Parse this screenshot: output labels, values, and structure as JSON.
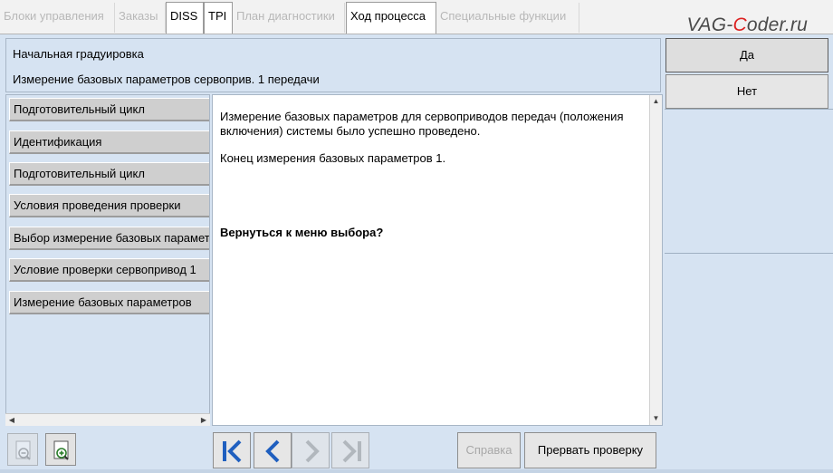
{
  "tabs": [
    {
      "label": "Блоки управления",
      "active": false
    },
    {
      "label": "Заказы",
      "active": false
    },
    {
      "label": "DISS",
      "active": true
    },
    {
      "label": "TPI",
      "active": true
    },
    {
      "label": "План диагностики",
      "active": false
    },
    {
      "label": "Ход процесса",
      "active": true
    },
    {
      "label": "Специальные функции",
      "active": false
    }
  ],
  "watermark": {
    "pre": "VAG-",
    "accent": "C",
    "post": "oder.ru"
  },
  "header": {
    "line1": "Начальная градуировка",
    "line2": "Измерение базовых параметров сервоприв. 1 передачи"
  },
  "steps": [
    "Подготовительный цикл",
    "Идентификация",
    "Подготовительный цикл",
    "Условия проведения проверки",
    "Выбор измерение базовых параметров",
    "Условие проверки сервопривод 1",
    "Измерение базовых параметров"
  ],
  "content": {
    "para1": "Измерение базовых параметров для сервоприводов передач (положения включения)  системы было успешно проведено.",
    "para2": "Конец измерения базовых параметров 1.",
    "question": "Вернуться к меню выбора?"
  },
  "answers": {
    "yes": "Да",
    "no": "Нет"
  },
  "toolbar": {
    "help_label": "Справка",
    "abort_label": "Прервать проверку"
  },
  "colors": {
    "background": "#d6e3f2",
    "nav_blue": "#1f5fbf",
    "disabled_gray": "#a8a8a8",
    "watermark_accent": "#d22222"
  }
}
